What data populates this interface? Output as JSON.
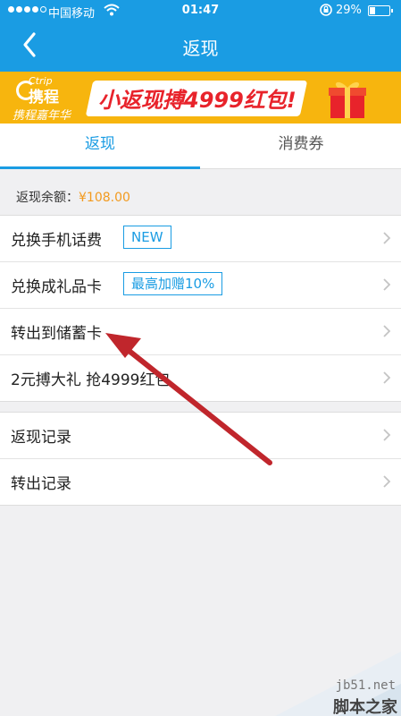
{
  "status_bar": {
    "carrier": "中国移动",
    "time": "01:47",
    "battery_pct": "29%",
    "battery_level": 0.29,
    "signal_bars": 5,
    "signal_filled": 4
  },
  "nav": {
    "title": "返现",
    "back_icon": "chevron-left-icon"
  },
  "banner": {
    "brand_en": "Ctrip",
    "brand_cn": "携程",
    "brand_sub": "携程嘉年华",
    "slogan": "小返现搏4999红包!",
    "gift_icon": "gift-box-icon"
  },
  "tabs": [
    {
      "label": "返现",
      "active": true
    },
    {
      "label": "消费券",
      "active": false
    }
  ],
  "balance": {
    "label": "返现余额：",
    "amount": "¥108.00"
  },
  "group1": [
    {
      "label": "兑换手机话费",
      "tag": "NEW"
    },
    {
      "label": "兑换成礼品卡",
      "tag": "最高加赠10%"
    },
    {
      "label": "转出到储蓄卡"
    },
    {
      "label": "2元搏大礼 抢4999红包"
    }
  ],
  "group2": [
    {
      "label": "返现记录"
    },
    {
      "label": "转出记录"
    }
  ],
  "watermark": {
    "domain": "jb51.net",
    "text": "脚本之家"
  },
  "colors": {
    "primary": "#1a9ce3",
    "banner": "#f7b50e",
    "amount": "#f29a1e",
    "arrow": "#c0262c"
  }
}
